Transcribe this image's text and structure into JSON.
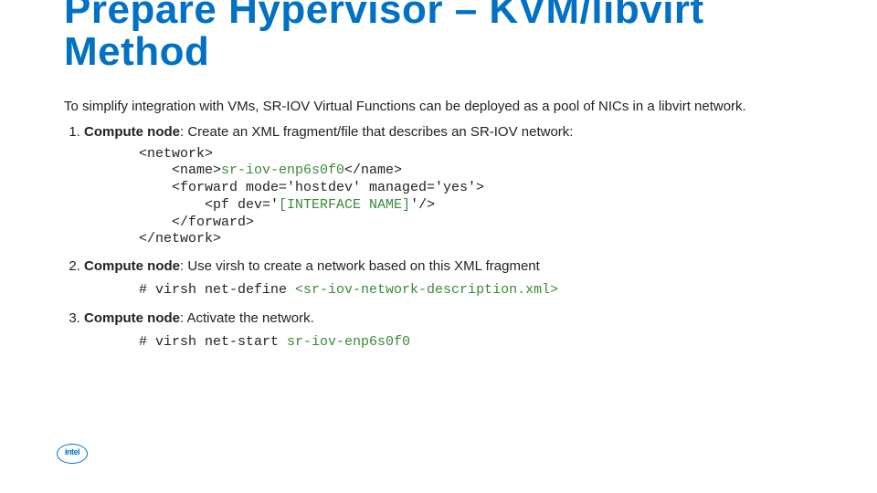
{
  "title": "Prepare Hypervisor – KVM/libvirt Method",
  "intro": "To simplify integration with VMs, SR-IOV Virtual Functions can be deployed as a pool of NICs in a libvirt network.",
  "steps": [
    {
      "label": "Compute node",
      "text": ": Create an XML fragment/file that describes an SR-IOV network:",
      "code_pre": "<network>\n    <name>",
      "code_green1": "sr-iov-enp6s0f0",
      "code_mid": "</name>\n    <forward mode='hostdev' managed='yes'>\n        <pf dev='",
      "code_green2": "[INTERFACE NAME]",
      "code_post": "'/>\n    </forward>\n</network>"
    },
    {
      "label": "Compute node",
      "text": ": Use virsh to create a network based on this XML fragment",
      "cmd_pre": "# virsh net-define ",
      "cmd_green": "<sr-iov-network-description.xml>"
    },
    {
      "label": "Compute node",
      "text": ": Activate the network.",
      "cmd_pre": "# virsh net-start ",
      "cmd_green": "sr-iov-enp6s0f0"
    }
  ],
  "logo": "intel"
}
